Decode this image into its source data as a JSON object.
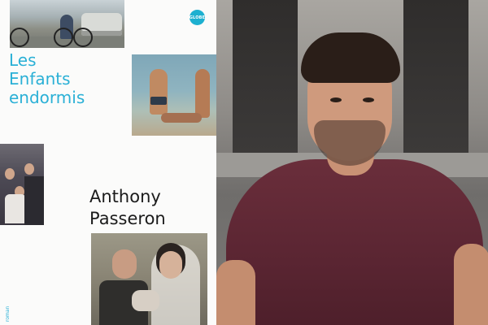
{
  "cover": {
    "publisher_badge": "GLOBE",
    "title_lines": [
      "Les",
      "Enfants",
      "endormis"
    ],
    "author_lines": [
      "Anthony",
      "Passeron"
    ],
    "genre": "roman",
    "accent_color": "#2ab0d6"
  },
  "author_photo": {
    "shirt_color": "#5a2532"
  }
}
